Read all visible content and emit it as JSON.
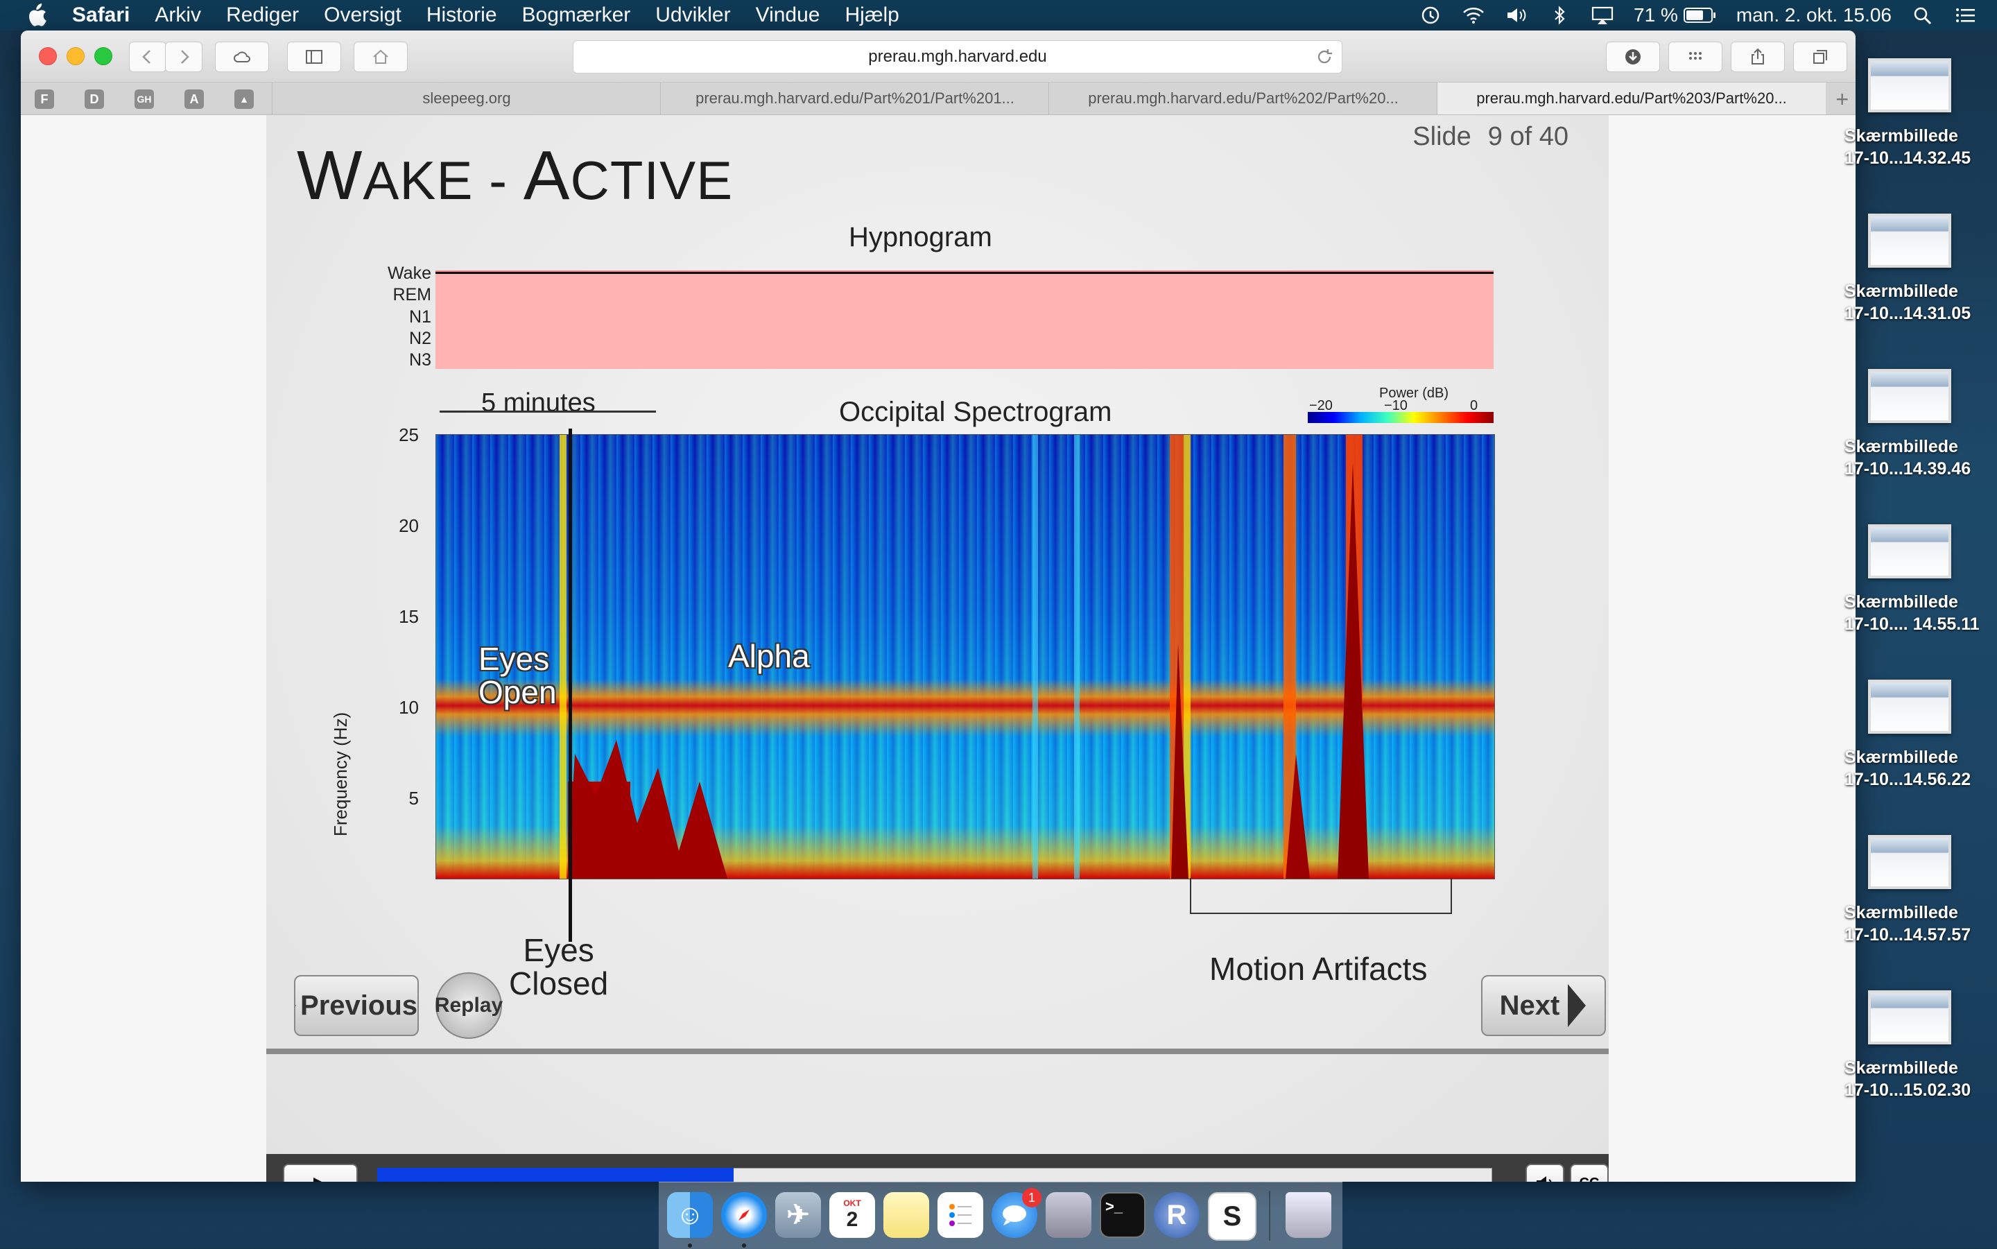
{
  "menubar": {
    "app": "Safari",
    "items": [
      "Arkiv",
      "Rediger",
      "Oversigt",
      "Historie",
      "Bogmærker",
      "Udvikler",
      "Vindue",
      "Hjælp"
    ],
    "battery": "71 %",
    "clock": "man. 2. okt. 15.06"
  },
  "browser": {
    "url": "prerau.mgh.harvard.edu",
    "favorites": [
      "F",
      "D",
      "GH",
      "A",
      "▲"
    ],
    "tabs": [
      {
        "label": "sleepeeg.org",
        "active": false
      },
      {
        "label": "prerau.mgh.harvard.edu/Part%201/Part%201...",
        "active": false
      },
      {
        "label": "prerau.mgh.harvard.edu/Part%202/Part%20...",
        "active": false
      },
      {
        "label": "prerau.mgh.harvard.edu/Part%203/Part%20...",
        "active": true
      }
    ]
  },
  "slide": {
    "counter_label": "Slide",
    "counter_value": "9 of 40",
    "title_first": "W",
    "title_rest": "AKE - ",
    "title_second": "A",
    "title_rest2": "CTIVE",
    "hypnogram_title": "Hypnogram",
    "hypnogram_stages": [
      "Wake",
      "REM",
      "N1",
      "N2",
      "N3"
    ],
    "scale_label": "5 minutes",
    "spectrogram_title": "Occipital Spectrogram",
    "power_label": "Power (dB)",
    "colorbar_ticks": [
      "−20",
      "−10",
      "0"
    ],
    "y_axis_label": "Frequency (Hz)",
    "y_ticks": [
      "25",
      "20",
      "15",
      "10",
      "5"
    ],
    "annotation_eyes_open_1": "Eyes",
    "annotation_eyes_open_2": "Open",
    "annotation_alpha": "Alpha",
    "annotation_eyes_closed_1": "Eyes",
    "annotation_eyes_closed_2": "Closed",
    "annotation_motion": "Motion Artifacts",
    "previous_label": "Previous",
    "replay_label": "Replay",
    "next_label": "Next"
  },
  "player": {
    "progress": 0.32,
    "cc_label": "CC"
  },
  "desktop_icons": [
    {
      "name": "Skærmbillede",
      "date": "17-10...14.32.45"
    },
    {
      "name": "Skærmbillede",
      "date": "17-10...14.31.05"
    },
    {
      "name": "Skærmbillede",
      "date": "17-10...14.39.46"
    },
    {
      "name": "Skærmbillede",
      "date": "17-10.... 14.55.11"
    },
    {
      "name": "Skærmbillede",
      "date": "17-10...14.56.22"
    },
    {
      "name": "Skærmbillede",
      "date": "17-10...14.57.57"
    },
    {
      "name": "Skærmbillede",
      "date": "17-10...15.02.30"
    }
  ],
  "dock": {
    "calendar_month": "OKT",
    "calendar_day": "2",
    "messages_badge": "1",
    "r_label": "R",
    "s_label": "S",
    "terminal_label": ">_"
  }
}
